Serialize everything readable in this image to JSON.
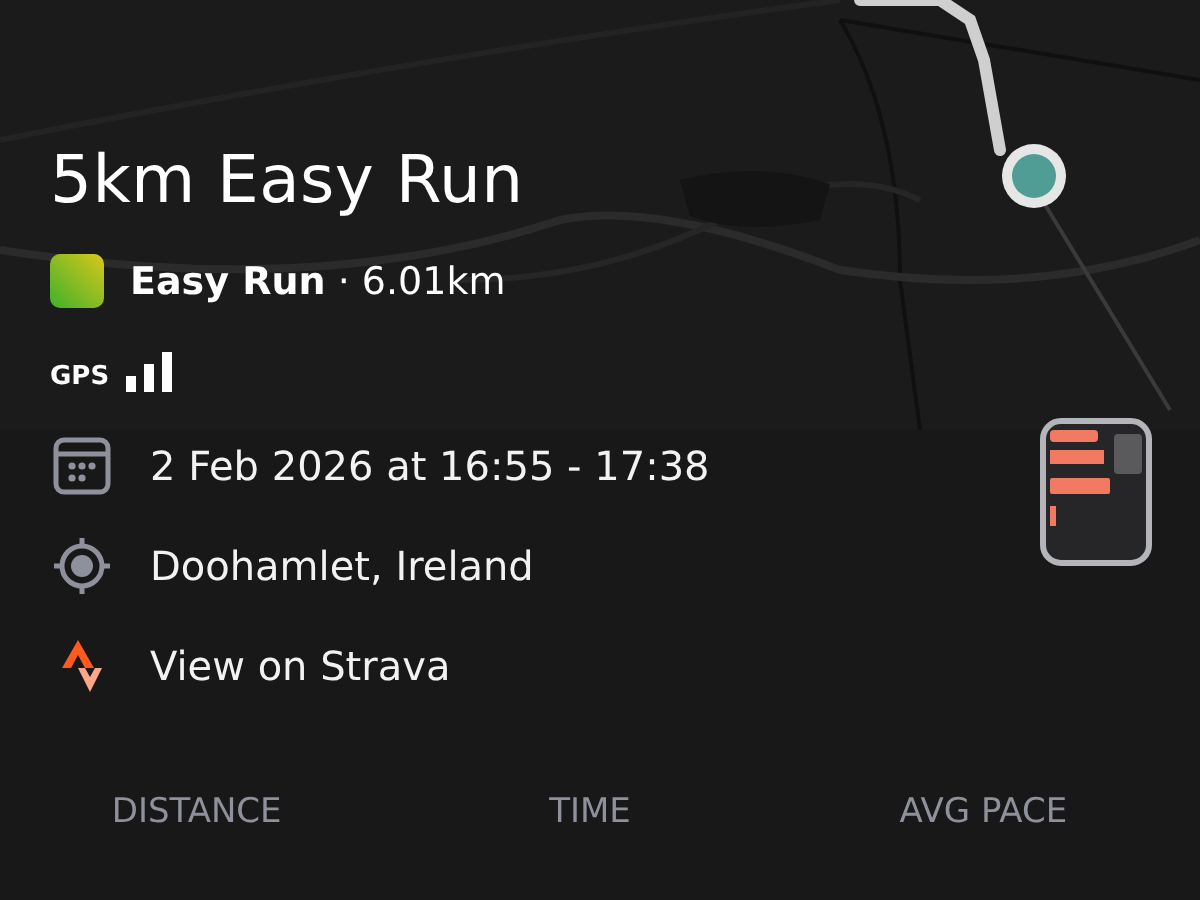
{
  "title": "5km Easy Run",
  "workout": {
    "type": "Easy Run",
    "separator": "·",
    "distance": "6.01km"
  },
  "gps": {
    "label": "GPS"
  },
  "details": [
    {
      "kind": "date",
      "text": "2 Feb 2026 at 16:55 - 17:38"
    },
    {
      "kind": "location",
      "text": "Doohamlet, Ireland"
    },
    {
      "kind": "link",
      "text": "View on Strava"
    }
  ],
  "stats": [
    {
      "label": "DISTANCE"
    },
    {
      "label": "TIME"
    },
    {
      "label": "AVG PACE"
    }
  ]
}
